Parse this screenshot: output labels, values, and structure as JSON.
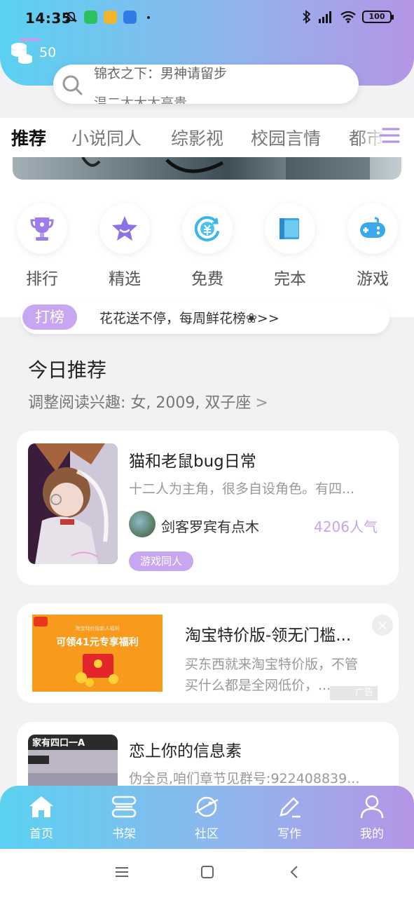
{
  "status_bar": {
    "time": "14:35",
    "battery": "100"
  },
  "header": {
    "coins": "50",
    "search_lines": [
      "锦衣之下：男神请留步",
      "温二太大太高贵"
    ]
  },
  "tabs": [
    {
      "label": "推荐",
      "active": true
    },
    {
      "label": "小说同人",
      "active": false
    },
    {
      "label": "综影视",
      "active": false
    },
    {
      "label": "校园言情",
      "active": false
    },
    {
      "label": "都市",
      "active": false
    }
  ],
  "quick_entries": [
    {
      "label": "排行",
      "icon": "trophy-icon"
    },
    {
      "label": "精选",
      "icon": "star-icon"
    },
    {
      "label": "免费",
      "icon": "free-coin-icon"
    },
    {
      "label": "完本",
      "icon": "book-icon"
    },
    {
      "label": "游戏",
      "icon": "gamepad-icon"
    }
  ],
  "notice": {
    "badge": "打榜",
    "text": "花花送不停，每周鲜花榜❀>>"
  },
  "recommend": {
    "title": "今日推荐",
    "subtitle": "调整阅读兴趣: 女, 2009, 双子座",
    "subtitle_arrow": ">"
  },
  "books": [
    {
      "title": "猫和老鼠bug日常",
      "desc": "十二人为主角，很多自设角色。有四...",
      "author": "剑客罗宾有点木",
      "popularity": "4206人气",
      "tag": "游戏同人"
    },
    {
      "title": "恋上你的信息素",
      "desc": "伪全员,咱们章节见群号:922408839..."
    }
  ],
  "ad": {
    "title": "淘宝特价版-领无门槛...",
    "desc": "买东西就来淘宝特价版，不管买什么都是全网低价，...",
    "badge": "广告",
    "image_small_text": "淘宝特价版新人福利",
    "image_big_text": "可领41元专享福利",
    "close": "×"
  },
  "cover3_text": "家有四口一A",
  "bottom_nav": [
    {
      "label": "首页",
      "icon": "home-icon"
    },
    {
      "label": "书架",
      "icon": "bookshelf-icon"
    },
    {
      "label": "社区",
      "icon": "community-planet-icon"
    },
    {
      "label": "写作",
      "icon": "pen-icon"
    },
    {
      "label": "我的",
      "icon": "profile-icon"
    }
  ],
  "colors": {
    "gradient_start": "#5ad1f0",
    "gradient_end": "#b595e6",
    "accent_purple": "#c7a7ef",
    "ad_orange": "#f79c1f"
  }
}
